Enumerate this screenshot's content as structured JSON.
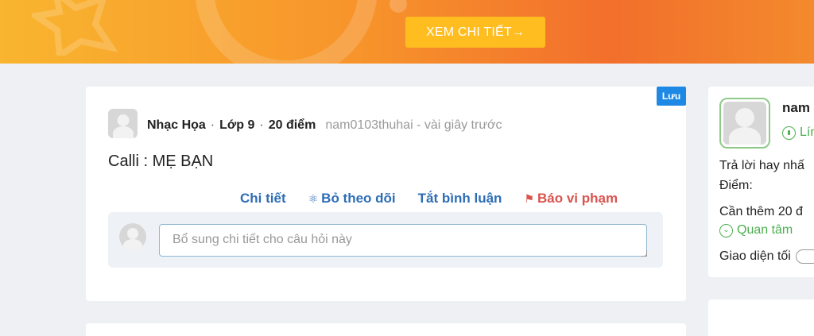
{
  "banner": {
    "cta_label": "XEM CHI TIẾT→",
    "colors": {
      "start": "#f9b52f",
      "end": "#f26f2c",
      "button": "#ffbd1f"
    }
  },
  "question_card": {
    "save_badge": "Lưu",
    "subject": "Nhạc Họa",
    "grade": "Lớp 9",
    "points": "20 điểm",
    "author": "nam0103thuhai - vài giây trước",
    "question_text": "Calli : MẸ BẠN",
    "actions": {
      "detail": "Chi tiết",
      "unfollow": "Bỏ theo dõi",
      "turn_off_comments": "Tắt bình luận",
      "report": "Báo vi phạm"
    },
    "comment_placeholder": "Bổ sung chi tiết cho câu hỏi này"
  },
  "profile_panel": {
    "name": "nam",
    "rank": "Lín",
    "best_answers": "Trả lời hay nhấ",
    "score_label": "Điểm:",
    "need_more": "Cần thêm 20 đ",
    "interest": "Quan tâm",
    "dark_mode": "Giao diện tối"
  },
  "accent_colors": {
    "link": "#2d6db6",
    "report": "#d9534f",
    "success": "#4caf50",
    "badge": "#1e88e5"
  }
}
